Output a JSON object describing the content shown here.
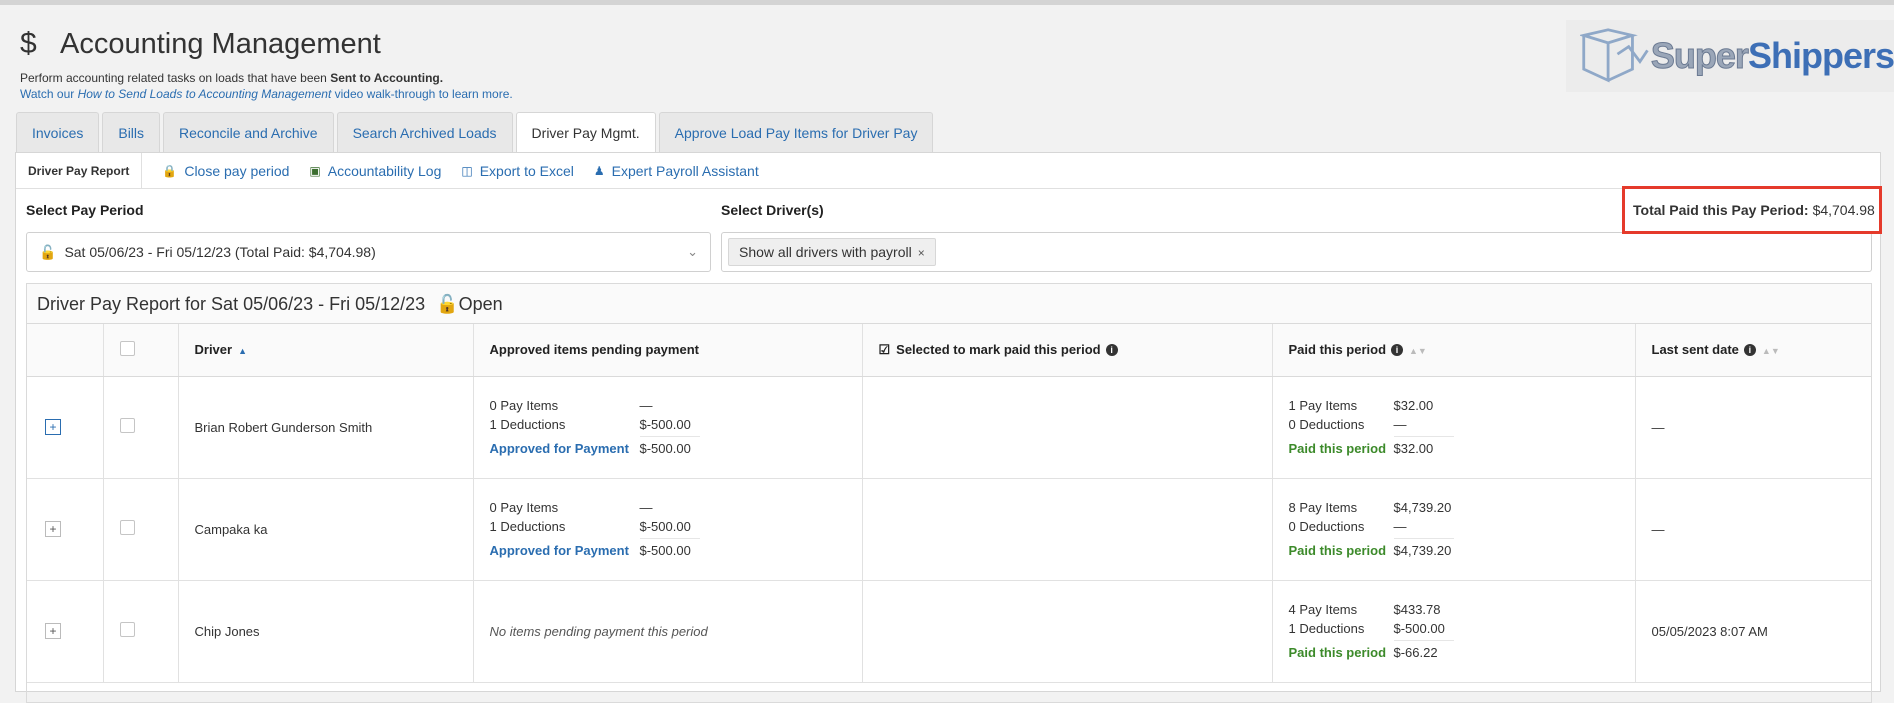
{
  "header": {
    "icon": "dollar-icon",
    "title": "Accounting Management",
    "subtitle_prefix": "Perform accounting related tasks on loads that have been ",
    "subtitle_bold": "Sent to Accounting.",
    "watch_prefix": "Watch our ",
    "watch_link": "How to Send Loads to Accounting Management",
    "watch_suffix": " video walk-through to learn more."
  },
  "logo": {
    "part1": "Super",
    "part2": "Shippers"
  },
  "tabs": [
    {
      "label": "Invoices"
    },
    {
      "label": "Bills"
    },
    {
      "label": "Reconcile and Archive"
    },
    {
      "label": "Search Archived Loads"
    },
    {
      "label": "Driver Pay Mgmt.",
      "active": true
    },
    {
      "label": "Approve Load Pay Items for Driver Pay"
    }
  ],
  "subbar": {
    "report": "Driver Pay Report",
    "close": "Close pay period",
    "log": "Accountability Log",
    "export": "Export to Excel",
    "assistant": "Expert Payroll Assistant"
  },
  "filters": {
    "period_label": "Select Pay Period",
    "period_value": "Sat 05/06/23 - Fri 05/12/23 (Total Paid: $4,704.98)",
    "drivers_label": "Select Driver(s)",
    "drivers_chip": "Show all drivers with payroll",
    "total_label": "Total Paid this Pay Period:",
    "total_value": "$4,704.98"
  },
  "report": {
    "title": "Driver Pay Report for Sat 05/06/23 - Fri 05/12/23",
    "status": "Open",
    "columns": {
      "driver": "Driver",
      "approved": "Approved items pending payment",
      "selected": "Selected to mark paid this period",
      "paid": "Paid this period",
      "last_sent": "Last sent date"
    },
    "rows": [
      {
        "driver": "Brian Robert Gunderson Smith",
        "approved": {
          "items_label": "0 Pay Items",
          "items_val": "—",
          "ded_label": "1 Deductions",
          "ded_val": "$-500.00",
          "total_label": "Approved for Payment",
          "total_val": "$-500.00"
        },
        "paid": {
          "items_label": "1 Pay Items",
          "items_val": "$32.00",
          "ded_label": "0 Deductions",
          "ded_val": "—",
          "total_label": "Paid this period",
          "total_val": "$32.00"
        },
        "last_sent": "—"
      },
      {
        "driver": "Campaka ka",
        "approved": {
          "items_label": "0 Pay Items",
          "items_val": "—",
          "ded_label": "1 Deductions",
          "ded_val": "$-500.00",
          "total_label": "Approved for Payment",
          "total_val": "$-500.00"
        },
        "paid": {
          "items_label": "8 Pay Items",
          "items_val": "$4,739.20",
          "ded_label": "0 Deductions",
          "ded_val": "—",
          "total_label": "Paid this period",
          "total_val": "$4,739.20"
        },
        "last_sent": "—"
      },
      {
        "driver": "Chip Jones",
        "approved_empty": "No items pending payment this period",
        "paid": {
          "items_label": "4 Pay Items",
          "items_val": "$433.78",
          "ded_label": "1 Deductions",
          "ded_val": "$-500.00",
          "total_label": "Paid this period",
          "total_val": "$-66.22"
        },
        "last_sent": "05/05/2023 8:07 AM"
      }
    ]
  }
}
